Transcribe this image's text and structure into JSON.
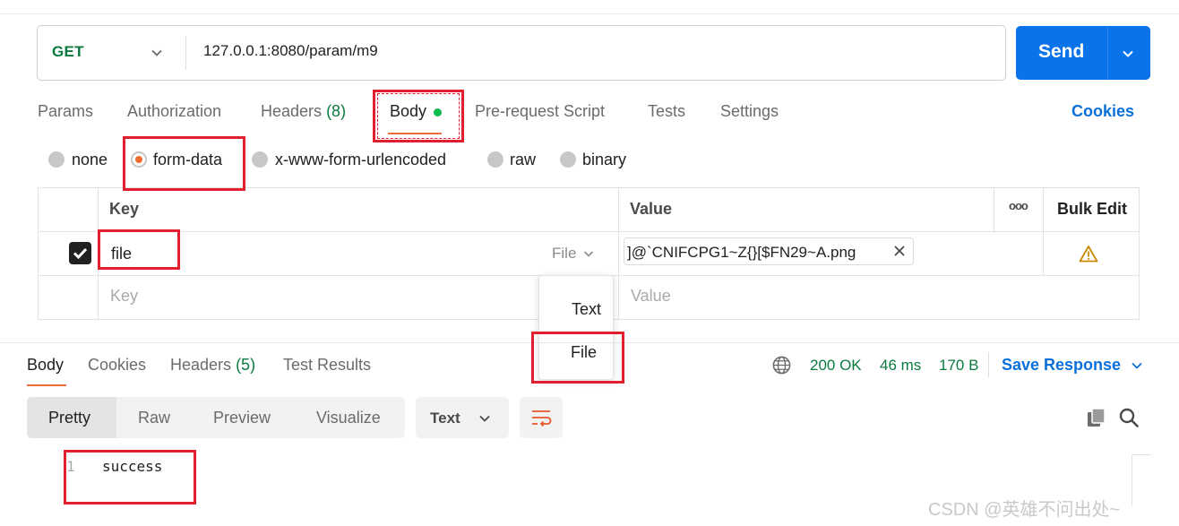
{
  "request": {
    "method": "GET",
    "url": "127.0.0.1:8080/param/m9",
    "send_label": "Send"
  },
  "request_tabs": {
    "params": "Params",
    "authorization": "Authorization",
    "headers": "Headers",
    "headers_count": "(8)",
    "body": "Body",
    "prerequest": "Pre-request Script",
    "tests": "Tests",
    "settings": "Settings",
    "cookies": "Cookies"
  },
  "body_types": {
    "none": "none",
    "form_data": "form-data",
    "urlencoded": "x-www-form-urlencoded",
    "raw": "raw",
    "binary": "binary",
    "selected": "form-data"
  },
  "form_table": {
    "key_header": "Key",
    "value_header": "Value",
    "more_label": "ooo",
    "bulk_edit": "Bulk Edit",
    "rows": [
      {
        "checked": true,
        "key": "file",
        "type": "File",
        "value": "]@`CNIFCPG1~Z{}[$FN29~A.png"
      }
    ],
    "key_placeholder": "Key",
    "value_placeholder": "Value"
  },
  "type_dropdown": {
    "options": [
      "Text",
      "File"
    ]
  },
  "response": {
    "tabs": {
      "body": "Body",
      "cookies": "Cookies",
      "headers": "Headers",
      "headers_count": "(5)",
      "test_results": "Test Results"
    },
    "status": "200 OK",
    "time": "46 ms",
    "size": "170 B",
    "save_response": "Save Response",
    "views": [
      "Pretty",
      "Raw",
      "Preview",
      "Visualize"
    ],
    "format": "Text",
    "lines": [
      {
        "number": "1",
        "content": "success"
      }
    ]
  },
  "watermark": "CSDN @英雄不问出处~",
  "colors": {
    "accent_blue": "#0a73ea",
    "status_green": "#0b7a3e",
    "tab_orange": "#ef6c3c",
    "annotation_red": "#e0202e"
  }
}
